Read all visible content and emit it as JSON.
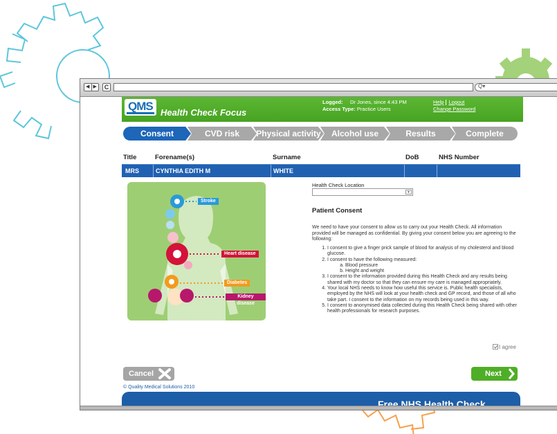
{
  "browser": {
    "url": "",
    "search_placeholder": "Q▾"
  },
  "header": {
    "logo": "QMS",
    "app_title": "Health Check Focus",
    "logged_label": "Logged:",
    "logged_value": "Dr Jones, since 4:43 PM",
    "access_label": "Access Type:",
    "access_value": "Practice Users",
    "help": "Help",
    "logout": "Logout",
    "change_password": "Change Password"
  },
  "steps": [
    {
      "label": "Consent",
      "active": true
    },
    {
      "label": "CVD risk",
      "active": false
    },
    {
      "label": "Physical activity",
      "active": false
    },
    {
      "label": "Alcohol use",
      "active": false
    },
    {
      "label": "Results",
      "active": false
    },
    {
      "label": "Complete",
      "active": false
    }
  ],
  "patient": {
    "headers": {
      "title": "Title",
      "forename": "Forename(s)",
      "surname": "Surname",
      "dob": "DoB",
      "nhs": "NHS Number"
    },
    "row": {
      "title": "MRS",
      "forename": "CYNTHIA EDITH M",
      "surname": "WHITE",
      "dob": "",
      "nhs": ""
    }
  },
  "illustration": {
    "labels": {
      "stroke": "Stroke",
      "heart": "Heart disease",
      "diabetes": "Diabetes",
      "kidney": "Kidney disease"
    },
    "colors": {
      "background": "#9ece74",
      "stroke": "#2a9ad8",
      "heart": "#d4123a",
      "diabetes": "#f39a1e",
      "kidney": "#b7186b"
    }
  },
  "form": {
    "location_label": "Health Check Location",
    "location_value": "",
    "consent_title": "Patient Consent",
    "intro": "We need to have your consent to allow us to carry out your Health Check. All information provided will be managed as confidential. By giving your consent below you are agreeing to the following:",
    "items": [
      "I consent to give a finger prick sample of blood for analysis of my cholesterol and blood glucose.",
      "I consent to have the following measured:",
      "I consent to the information provided during this Health Check and any results being shared with my doctor so that they can ensure my care is managed appropriately.",
      "Your local NHS needs to know how useful this service is. Public health specialists, employed by the NHS will look at your health check and GP record, and those of all who take part. I consent to the information on my records being used in this way.",
      "I consent to anonymised data collected during this Health Check being shared with other health professionals for research purposes."
    ],
    "sub_items": [
      "Blood pressure",
      "Height and weight"
    ],
    "agree_label": "I agree",
    "agree_checked": true
  },
  "actions": {
    "cancel": "Cancel",
    "next": "Next"
  },
  "footer": {
    "copyright": "© Quality Medical Solutions 2010",
    "banner": "Free NHS Health Check"
  },
  "colors": {
    "green": "#4fae27",
    "blue": "#1d66b8",
    "grey": "#a8a8a8"
  }
}
